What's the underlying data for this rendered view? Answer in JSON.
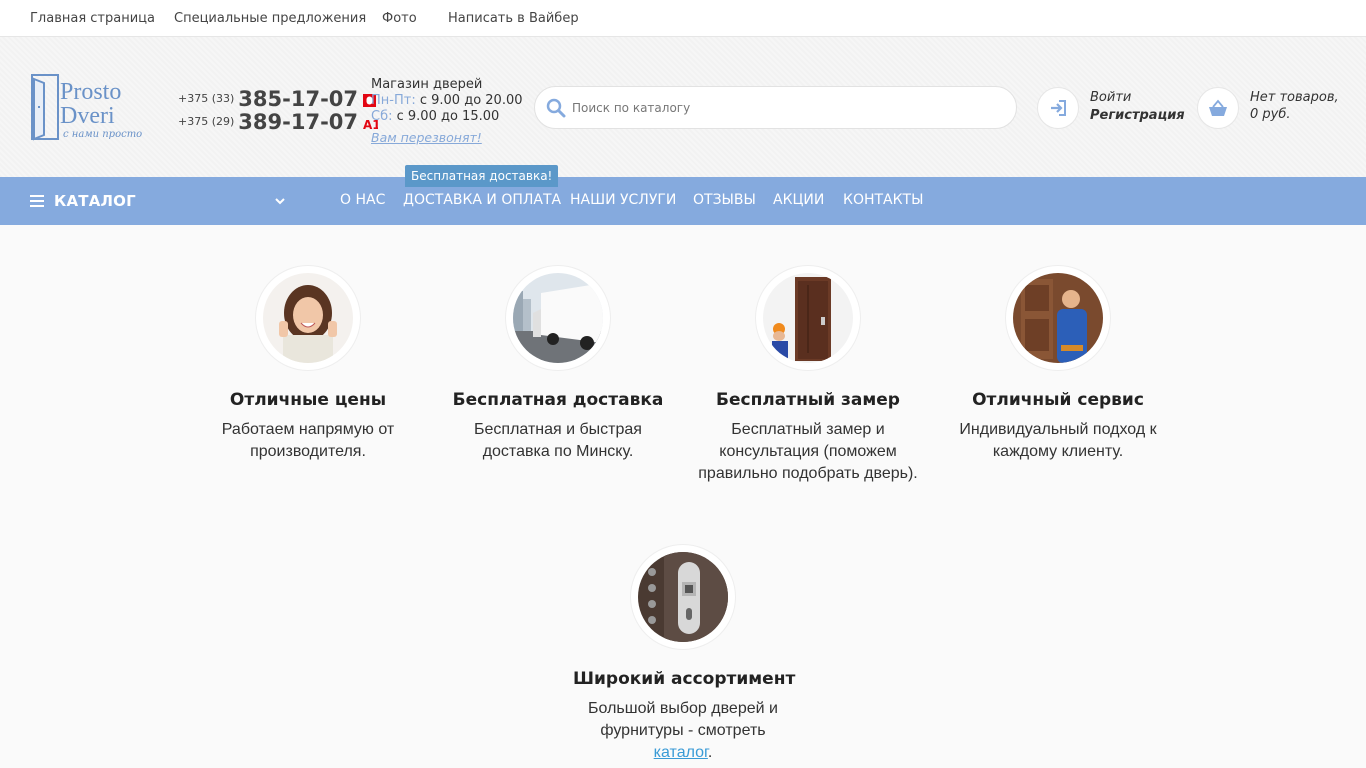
{
  "topbar": {
    "links": [
      "Главная страница",
      "Специальные предложения",
      "Фото",
      "Написать в Вайбер"
    ]
  },
  "header": {
    "logo": {
      "line1": "Prosto",
      "line2": "Dveri",
      "tagline": "с нами просто"
    },
    "phones": [
      {
        "code": "+375 (33)",
        "number": "385-17-07",
        "operator_icon": "mts-icon",
        "color": "#e30613"
      },
      {
        "code": "+375 (29)",
        "number": "389-17-07",
        "operator_icon": "a1-icon",
        "color": "#e30613"
      }
    ],
    "shop": {
      "title": "Магазин дверей",
      "weekday_label": "Пн-Пт:",
      "weekday_hours": "с 9.00 до 20.00",
      "saturday_label": "Сб:",
      "saturday_hours": "с 9.00 до 15.00",
      "callback": "Вам перезвонят!"
    },
    "search": {
      "placeholder": "Поиск по каталогу",
      "value": "",
      "icon": "search-icon"
    },
    "account": {
      "login": "Войти",
      "register": "Регистрация",
      "icon": "login-icon"
    },
    "cart": {
      "line1": "Нет товаров,",
      "line2": "0 руб.",
      "icon": "basket-icon"
    }
  },
  "nav": {
    "catalog_label": "КАТАЛОГ",
    "items": [
      "О НАС",
      "ДОСТАВКА И ОПЛАТА",
      "НАШИ УСЛУГИ",
      "ОТЗЫВЫ",
      "АКЦИИ",
      "КОНТАКТЫ"
    ],
    "badge": "Бесплатная доставка!",
    "accent_color": "#85aade"
  },
  "features": [
    {
      "title": "Отличные цены",
      "text": "Работаем напрямую от производителя."
    },
    {
      "title": "Бесплатная доставка",
      "text": "Бесплатная и быстрая доставка по Минску."
    },
    {
      "title": "Бесплатный замер",
      "text": "Бесплатный замер и консультация (поможем правильно подобрать дверь)."
    },
    {
      "title": "Отличный сервис",
      "text": "Индивидуальный подход к каждому клиенту."
    },
    {
      "title": "Широкий ассортимент",
      "text_before": "Большой выбор дверей и фурнитуры - смотреть",
      "link": "каталог",
      "text_after": "."
    }
  ]
}
